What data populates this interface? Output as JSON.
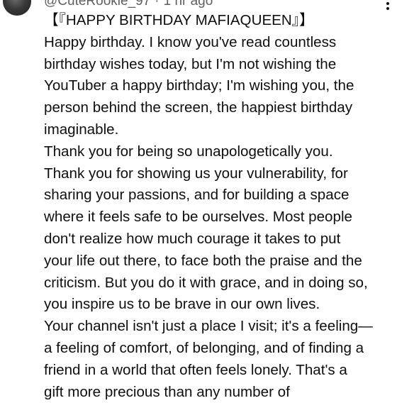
{
  "comment": {
    "author": "@CuteRookie_97",
    "timestamp": "1 hr ago",
    "title": "【『HAPPY BIRTHDAY MAFIAQUEEN』】",
    "lines": [
      "Happy birthday. I know you've read countless",
      "birthday wishes today, but I'm not wishing the",
      "YouTuber a happy birthday; I'm wishing you, the",
      "person behind the screen, the happiest birthday",
      "imaginable.",
      "Thank you for being so unapologetically you.",
      "Thank you for showing us your vulnerability, for",
      "sharing your passions, and for building a space",
      "where it feels safe to be ourselves. Most people",
      "don't realize how much courage it takes to put",
      "your life out there, to face both the praise and the",
      "criticism. But you do it with grace, and in doing so,",
      "you inspire us to be brave in our own lives.",
      "Your channel isn't just a place I visit; it's a feeling—",
      "a feeling of comfort, of belonging, and of finding a",
      "friend in a world that often feels lonely. That's a",
      "gift more precious than any number of"
    ]
  },
  "icons": {
    "menu": "more-vert-icon"
  }
}
